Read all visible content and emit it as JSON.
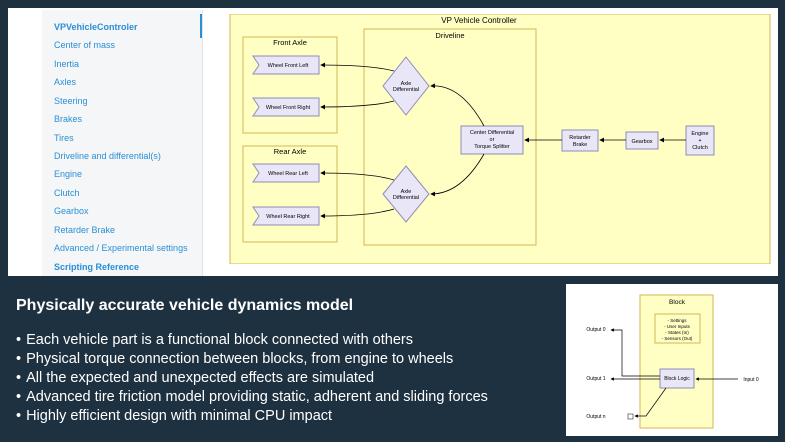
{
  "sidebar": {
    "items": [
      {
        "label": "VPVehicleControler",
        "bold": true
      },
      {
        "label": "Center of mass"
      },
      {
        "label": "Inertia"
      },
      {
        "label": "Axles"
      },
      {
        "label": "Steering"
      },
      {
        "label": "Brakes"
      },
      {
        "label": "Tires"
      },
      {
        "label": "Driveline and differential(s)"
      },
      {
        "label": "Engine"
      },
      {
        "label": "Clutch"
      },
      {
        "label": "Gearbox"
      },
      {
        "label": "Retarder Brake"
      },
      {
        "label": "Advanced / Experimental settings"
      },
      {
        "label": "Scripting Reference",
        "bold": true
      }
    ]
  },
  "vehicle_diagram": {
    "title": "VP Vehicle Controller",
    "front_axle": "Front Axle",
    "rear_axle": "Rear Axle",
    "driveline": "Driveline",
    "wheel_front_left": "Wheel Front Left",
    "wheel_front_right": "Wheel Front Right",
    "wheel_rear_left": "Wheel Rear Left",
    "wheel_rear_right": "Wheel Rear Right",
    "axle_diff_line1": "Axle",
    "axle_diff_line2": "Differential",
    "center_diff_line1": "Center Differential",
    "center_diff_line2": "or",
    "center_diff_line3": "Torque Splitter",
    "retarder_line1": "Retarder",
    "retarder_line2": "Brake",
    "gearbox": "Gearbox",
    "engine_line1": "Engine",
    "engine_line2": "+",
    "engine_line3": "Clutch"
  },
  "headline": "Physically accurate vehicle dynamics model",
  "bullets": [
    "Each vehicle part is a functional block connected with others",
    "Physical torque connection between blocks, from engine to wheels",
    "All the expected and unexpected effects are simulated",
    "Advanced tire friction model providing static, adherent and sliding forces",
    "Highly efficient design with minimal CPU impact"
  ],
  "block_diagram": {
    "title": "Block",
    "settings": "- Settings",
    "user_inputs": "- User Inputs",
    "states_in": "- States (In)",
    "sensors_out": "- Sensors (Out)",
    "block_logic": "Block Logic",
    "input_0": "Input 0",
    "output_0": "Output 0",
    "output_1": "Output 1",
    "output_n": "Output n"
  },
  "colors": {
    "background": "#1e3140",
    "link": "#2a8fd6",
    "diagram_fill": "#ffffc4",
    "diagram_border": "#d6b656",
    "node_fill": "#e8e6f7",
    "node_border": "#8f8bb8"
  }
}
